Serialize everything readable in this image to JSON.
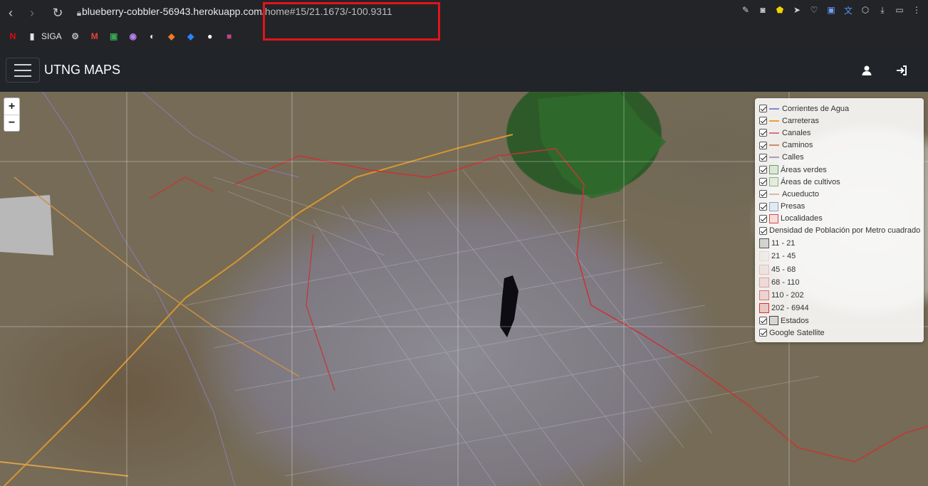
{
  "browser": {
    "url_host": "blueberry-cobbler-56943.herokuapp.com",
    "url_path": "/home#15/21.1673/-100.9311",
    "bookmarks": [
      {
        "name": "netflix",
        "label": "",
        "color": "#e50914",
        "glyph": "N"
      },
      {
        "name": "siga",
        "label": "SIGA",
        "color": "#e5e5e5",
        "glyph": "▮"
      },
      {
        "name": "translate-ext",
        "label": "",
        "color": "#bdbdbd",
        "glyph": "⚙"
      },
      {
        "name": "gmail",
        "label": "",
        "color": "#ea4335",
        "glyph": "M"
      },
      {
        "name": "meet",
        "label": "",
        "color": "#34a853",
        "glyph": "▣"
      },
      {
        "name": "photos",
        "label": "",
        "color": "#b980f0",
        "glyph": "◉"
      },
      {
        "name": "compass",
        "label": "",
        "color": "#f4f4f4",
        "glyph": "◐"
      },
      {
        "name": "codepen",
        "label": "",
        "color": "#f07a22",
        "glyph": "◆"
      },
      {
        "name": "jira",
        "label": "",
        "color": "#2684ff",
        "glyph": "◆"
      },
      {
        "name": "github",
        "label": "",
        "color": "#ffffff",
        "glyph": "●"
      },
      {
        "name": "app",
        "label": "",
        "color": "#c2418f",
        "glyph": "■"
      }
    ]
  },
  "navbar": {
    "brand": "UTNG MAPS"
  },
  "zoom": {
    "in": "+",
    "out": "−"
  },
  "layers": {
    "overlays": [
      {
        "label": "Corrientes de Agua",
        "checked": true,
        "swatch": "line",
        "color": "#7b8fc8"
      },
      {
        "label": "Carreteras",
        "checked": true,
        "swatch": "line",
        "color": "#e8a13a"
      },
      {
        "label": "Canales",
        "checked": true,
        "swatch": "line",
        "color": "#d9738a"
      },
      {
        "label": "Caminos",
        "checked": true,
        "swatch": "line",
        "color": "#cf8a70"
      },
      {
        "label": "Calles",
        "checked": true,
        "swatch": "line",
        "color": "#a99bbd"
      },
      {
        "label": "Áreas verdes",
        "checked": true,
        "swatch": "box",
        "color": "#6a9e63"
      },
      {
        "label": "Áreas de cultivos",
        "checked": true,
        "swatch": "box",
        "color": "#8bb07a"
      },
      {
        "label": "Acueducto",
        "checked": true,
        "swatch": "line",
        "color": "#d8b9a3"
      },
      {
        "label": "Presas",
        "checked": true,
        "swatch": "box",
        "color": "#8aa6c9"
      },
      {
        "label": "Localidades",
        "checked": true,
        "swatch": "box",
        "color": "#d94a4a"
      },
      {
        "label": "Densidad de Población por Metro cuadrado",
        "checked": true,
        "swatch": "none",
        "color": ""
      }
    ],
    "density_classes": [
      {
        "label": "11 - 21",
        "color": "#555555"
      },
      {
        "label": "21 - 45",
        "color": "#e8d6d6"
      },
      {
        "label": "45 - 68",
        "color": "#e8bcbc"
      },
      {
        "label": "68 - 110",
        "color": "#e29d9d"
      },
      {
        "label": "110 - 202",
        "color": "#dd7474"
      },
      {
        "label": "202 - 6944",
        "color": "#d9342f"
      }
    ],
    "bottom": [
      {
        "label": "Estados",
        "checked": true,
        "swatch": "box",
        "color": "#444444"
      },
      {
        "label": "Google Satellite",
        "checked": true,
        "swatch": "none",
        "color": ""
      }
    ]
  }
}
